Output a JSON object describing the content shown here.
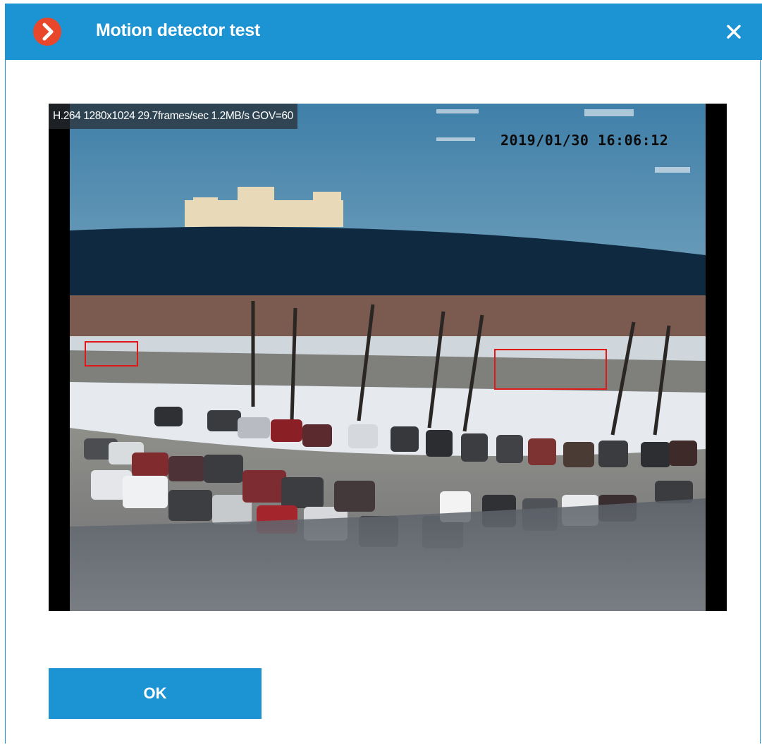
{
  "dialog": {
    "title": "Motion detector test",
    "close_icon": "close-icon",
    "logo_icon": "app-logo-icon",
    "accent_color": "#1c93d2",
    "logo_color": "#e8472b"
  },
  "video": {
    "stream_info": "H.264 1280x1024 29.7frames/sec 1.2MB/s GOV=60",
    "timestamp": "2019/01/30 16:06:12",
    "motion_box_color": "#e01818",
    "motion_regions_count": 2
  },
  "footer": {
    "ok_label": "OK"
  }
}
